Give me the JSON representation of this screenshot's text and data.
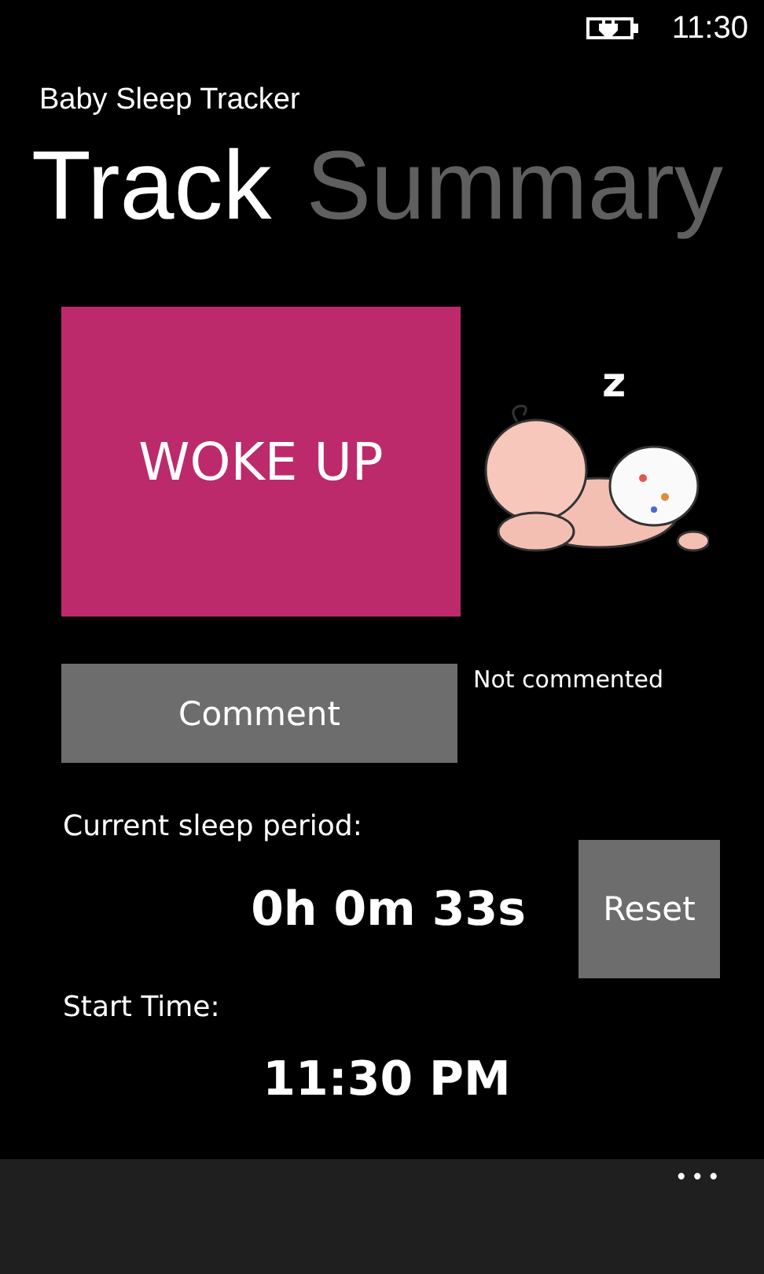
{
  "status_bar": {
    "time": "11:30"
  },
  "app_title": "Baby Sleep Tracker",
  "pivots": [
    {
      "label": "Track",
      "selected": true
    },
    {
      "label": "Summary",
      "selected": false
    }
  ],
  "woke_button": "WOKE UP",
  "sleep_mark": "z",
  "comment_button": "Comment",
  "comment_status": "Not commented",
  "period_label": "Current sleep period:",
  "period_value": "0h 0m 33s",
  "reset_button": "Reset",
  "start_label": "Start Time:",
  "start_value": "11:30 PM",
  "app_bar": {
    "more": "•••"
  }
}
